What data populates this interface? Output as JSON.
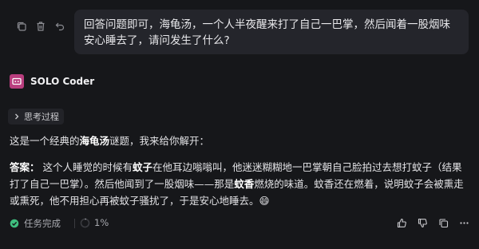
{
  "user_message": {
    "text": "回答问题即可，海龟汤，一个人半夜醒来打了自己一巴掌，然后闻着一股烟味安心睡去了，请问发生了什么?",
    "actions": [
      "copy-icon",
      "delete-icon",
      "undo-icon"
    ]
  },
  "agent": {
    "name": "SOLO Coder",
    "logo_icon": "solo-coder-logo-icon"
  },
  "thinking": {
    "label": "思考过程",
    "icon": "chevron-right-icon"
  },
  "response": {
    "intro": {
      "before": "这是一个经典的",
      "bold": "海龟汤",
      "after": "谜题，我来给你解开："
    },
    "answer": {
      "label": "答案：",
      "part1": " 这个人睡觉的时候有",
      "bold1": "蚊子",
      "part2": "在他耳边嗡嗡叫，他迷迷糊糊地一巴掌朝自己脸拍过去想打蚊子（结果打了自己一巴掌）。然后他闻到了一股烟味——那是",
      "bold2": "蚊香",
      "part3": "燃烧的味道。蚊香还在燃着，说明蚊子会被熏走或熏死，他不用担心再被蚊子骚扰了，于是安心地睡去。",
      "emoji": "😄"
    }
  },
  "footer": {
    "status_label": "任务完成",
    "status_icon": "check-circle-icon",
    "progress_text": "1%",
    "progress_value": 0.01,
    "feedback_icons": [
      "thumbs-up-icon",
      "thumbs-down-icon",
      "copy-icon",
      "more-icon"
    ]
  },
  "colors": {
    "background": "#16171a",
    "bubble": "#24252b",
    "logo": "#b93e7e",
    "success": "#3fbf7f"
  }
}
